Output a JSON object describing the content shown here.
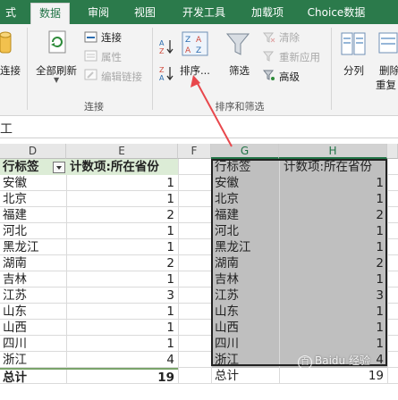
{
  "tabs": [
    {
      "label": "式",
      "active": false
    },
    {
      "label": "数据",
      "active": true
    },
    {
      "label": "审阅",
      "active": false
    },
    {
      "label": "视图",
      "active": false
    },
    {
      "label": "开发工具",
      "active": false
    },
    {
      "label": "加载项",
      "active": false
    },
    {
      "label": "Choice数据",
      "active": false
    }
  ],
  "ribbon": {
    "connect_partial": "连接",
    "refresh_all": "全部刷新",
    "connections": "连接",
    "properties": "属性",
    "edit_links": "编辑链接",
    "group_connections": "连接",
    "sort_asc_icon_text": "A↓Z",
    "sort_desc_icon_text": "Z↓A",
    "sort": "排序...",
    "filter": "筛选",
    "clear": "清除",
    "reapply": "重新应用",
    "advanced": "高级",
    "group_sort_filter": "排序和筛选",
    "split": "分列",
    "remove_dup_1": "删除",
    "remove_dup_2": "重复"
  },
  "formula_bar": {
    "text": "工"
  },
  "columns": {
    "d": "D",
    "e": "E",
    "f": "F",
    "g": "G",
    "h": "H"
  },
  "pivot": {
    "row_label": "行标签",
    "count_label": "计数项:所在省份",
    "total_label": "总计",
    "total": "19",
    "rows": [
      {
        "name": "安徽",
        "count": "1"
      },
      {
        "name": "北京",
        "count": "1"
      },
      {
        "name": "福建",
        "count": "2"
      },
      {
        "name": "河北",
        "count": "1"
      },
      {
        "name": "黑龙江",
        "count": "1"
      },
      {
        "name": "湖南",
        "count": "2"
      },
      {
        "name": "吉林",
        "count": "1"
      },
      {
        "name": "江苏",
        "count": "3"
      },
      {
        "name": "山东",
        "count": "1"
      },
      {
        "name": "山西",
        "count": "1"
      },
      {
        "name": "四川",
        "count": "1"
      },
      {
        "name": "浙江",
        "count": "4"
      }
    ]
  },
  "copy": {
    "row_label": "行标签",
    "count_label": "计数项:所在省份",
    "total_label": "总计",
    "total": "19",
    "rows": [
      {
        "name": "安徽",
        "count": "1"
      },
      {
        "name": "北京",
        "count": "1"
      },
      {
        "name": "福建",
        "count": "2"
      },
      {
        "name": "河北",
        "count": "1"
      },
      {
        "name": "黑龙江",
        "count": "1"
      },
      {
        "name": "湖南",
        "count": "2"
      },
      {
        "name": "吉林",
        "count": "1"
      },
      {
        "name": "江苏",
        "count": "3"
      },
      {
        "name": "山东",
        "count": "1"
      },
      {
        "name": "山西",
        "count": "1"
      },
      {
        "name": "四川",
        "count": "1"
      },
      {
        "name": "浙江",
        "count": "4"
      }
    ]
  },
  "watermark": {
    "text": "Baidu 经验",
    "badge": "百"
  },
  "colors": {
    "excel_green": "#217346",
    "arrow": "#e8474c",
    "pivot_header": "#dcecd6",
    "selection": "#bfbfbf"
  }
}
